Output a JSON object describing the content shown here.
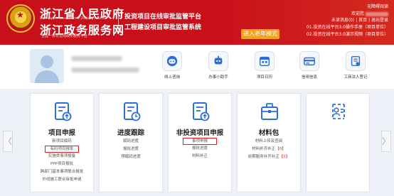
{
  "header": {
    "brand_line1": "浙江省人民政府",
    "brand_line1_en": "The People's Government of Zhejiang Province",
    "brand_line2": "浙江政务服务网",
    "brand_line2_sub": "全国一体化在线政务服务平台",
    "platform_line1": "投资项目在线审批监管平台",
    "platform_line2": "工程建设项目审批监管系统",
    "elder_mode": "进入老年模式",
    "accessibility": "无障碍阅读",
    "welcome": "欢迎您",
    "account_links": "未读消息(0) | 首页 | 退出登录",
    "notice1": "01.投资在线平台3.0操作手册（项目单位）",
    "notice2": "02.投资在线平台3.0演示视频（项目单位）"
  },
  "quick_nav": [
    {
      "label": "线上咨询",
      "icon": "robot-icon",
      "name": "quick-online-consult"
    },
    {
      "label": "办事小助手",
      "icon": "assistant-icon",
      "name": "quick-assistant"
    },
    {
      "label": "项目日历",
      "icon": "calendar-icon",
      "name": "quick-project-calendar"
    },
    {
      "label": "信用信息",
      "icon": "credit-card-icon",
      "name": "quick-credit-info"
    },
    {
      "label": "工商法人登记",
      "icon": "registration-icon",
      "name": "quick-business-registration"
    }
  ],
  "cards": [
    {
      "title": "项目申报",
      "icon": "document-upload-icon",
      "links": [
        "新项目赋码",
        "有码项目报批",
        "实施类事项报备",
        "PPP项目报批",
        "跨部门基本事项联合报批",
        "外线施工联合审批申请"
      ],
      "highlight_index": 1
    },
    {
      "title": "进度跟踪",
      "icon": "progress-clock-icon",
      "links": [
        "赋码进度",
        "报批进度",
        "预赋码进度"
      ],
      "highlight_index": -1
    },
    {
      "title": "非投资项目申报",
      "icon": "document-upload-icon",
      "links": [
        "事项申报",
        "报批进度",
        "材料补正"
      ],
      "highlight_index": 0
    },
    {
      "title": "材料包",
      "icon": "briefcase-icon",
      "links": [
        "材料上传及查阅",
        "材料补齐补正",
        "前期服务补齐补正"
      ],
      "badges": [
        "",
        "【0】",
        "【0】"
      ],
      "highlight_index": -1
    },
    {
      "title": "",
      "icon": "user-card-icon",
      "links": [],
      "highlight_index": -1
    }
  ],
  "colors": {
    "header_red": "#c8101a",
    "accent_orange": "#f5a21b",
    "highlight_red": "#e02020",
    "icon_blue": "#2b6fd6"
  }
}
